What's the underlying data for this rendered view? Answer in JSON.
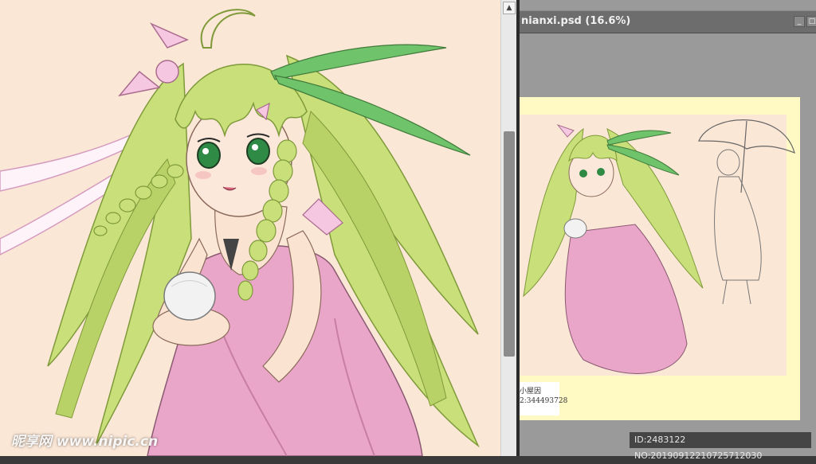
{
  "document_window": {
    "title": "nianxi.psd (16.6%)",
    "minimize_glyph": "_",
    "close_glyph": "□"
  },
  "scrollbar": {
    "up_arrow_glyph": "▲",
    "thumb_position": 0.29
  },
  "artwork": {
    "stamp_line1": "小屋因",
    "stamp_line2": "2:344493728"
  },
  "overlay": {
    "id_text": "ID:2483122 NO:20190912210725712030",
    "watermark_text": "昵享网 www.nipic.cn"
  },
  "colors": {
    "canvas_bg": "#fbe7d6",
    "hair": "#c8df7a",
    "dress": "#eaa6c8",
    "doc_bg": "#fff9c4",
    "workspace": "#9a9a9a"
  }
}
